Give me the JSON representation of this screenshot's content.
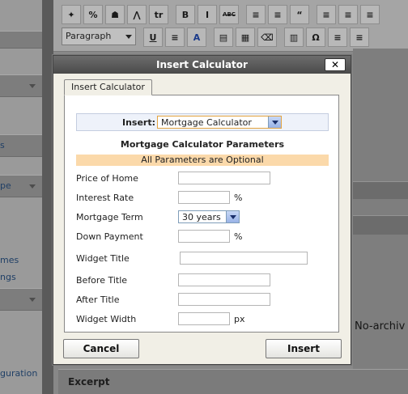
{
  "editor": {
    "toolbar_row1": [
      "✦",
      "%",
      "☗",
      "⋀",
      "tr",
      "B",
      "I",
      "ABC",
      "≡",
      "≡",
      "“",
      "≡",
      "≡",
      "≡"
    ],
    "toolbar_row2_icons": [
      "U",
      "≡",
      "A",
      "▤",
      "▦",
      "⌫",
      "▥",
      "Ω",
      "≡",
      "≡"
    ],
    "format_select": "Paragraph",
    "sidebar_fragments": [
      "s",
      "pe",
      "mes",
      "ngs",
      "guration"
    ],
    "no_archive_text": "No-archiv",
    "excerpt_title": "Excerpt"
  },
  "dialog": {
    "title": "Insert Calculator",
    "close_label": "✕",
    "tab_label": "Insert Calculator",
    "insert_label": "Insert:",
    "insert_selected": "Mortgage Calculator",
    "section_title": "Mortgage Calculator Parameters",
    "notice": "All Parameters are Optional",
    "notice_color": "#fbd9aa",
    "fields": {
      "price_of_home": {
        "label": "Price of Home",
        "value": ""
      },
      "interest_rate": {
        "label": "Interest Rate",
        "value": "",
        "unit": "%"
      },
      "mortgage_term": {
        "label": "Mortgage Term",
        "selected": "30 years"
      },
      "down_payment": {
        "label": "Down Payment",
        "value": "",
        "unit": "%"
      },
      "widget_title": {
        "label": "Widget Title",
        "value": ""
      },
      "before_title": {
        "label": "Before Title",
        "value": ""
      },
      "after_title": {
        "label": "After Title",
        "value": ""
      },
      "widget_width": {
        "label": "Widget Width",
        "value": "",
        "unit": "px"
      }
    },
    "cancel_label": "Cancel",
    "insert_button_label": "Insert"
  }
}
